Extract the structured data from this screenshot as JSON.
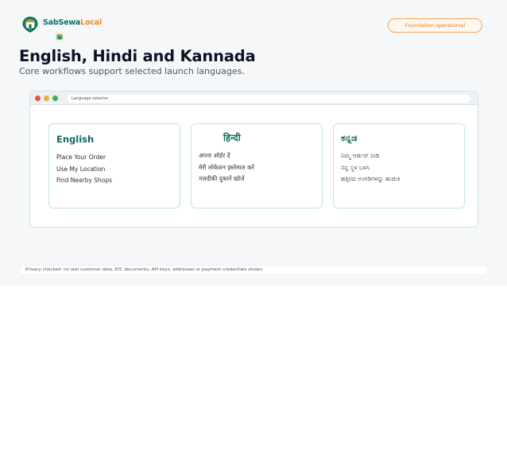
{
  "brand": {
    "name_part1": "SabSewa",
    "name_part2": "Local",
    "logo_icon": "shop-pin-icon",
    "colors": {
      "teal": "#0f6b6a",
      "orange": "#f08a1c",
      "green": "#3fae53"
    }
  },
  "header": {
    "status": "Foundation operational",
    "status_color": "#e0801f"
  },
  "hero": {
    "title": "English, Hindi and Kannada",
    "subtitle": "Core workflows support selected launch languages."
  },
  "window": {
    "address": "Language selector",
    "traffic_lights": [
      "#e5534b",
      "#e7b52b",
      "#3fae53"
    ]
  },
  "languages": [
    {
      "title": "English",
      "items": [
        "Place Your Order",
        "Use My Location",
        "Find Nearby Shops"
      ]
    },
    {
      "title": "हिन्दी",
      "items": [
        "अपना ऑर्डर दें",
        "मेरी लोकेशन इस्तेमाल करें",
        "नज़दीकी दुकानें खोजें"
      ]
    },
    {
      "title": "ಕನ್ನಡ",
      "items": [
        "ನಿಮ್ಮ ಆರ್ಡರ್ ನೀಡಿ",
        "ನನ್ನ ಸ್ಥಳ ಬಳಸಿ",
        "ಹತ್ತಿರದ ಅಂಗಡಿಗಳನ್ನು ಹುಡುಕಿ"
      ]
    }
  ],
  "footer": {
    "privacy": "Privacy checked: no real customer data, KYC documents, API keys, addresses or payment credentials shown."
  }
}
